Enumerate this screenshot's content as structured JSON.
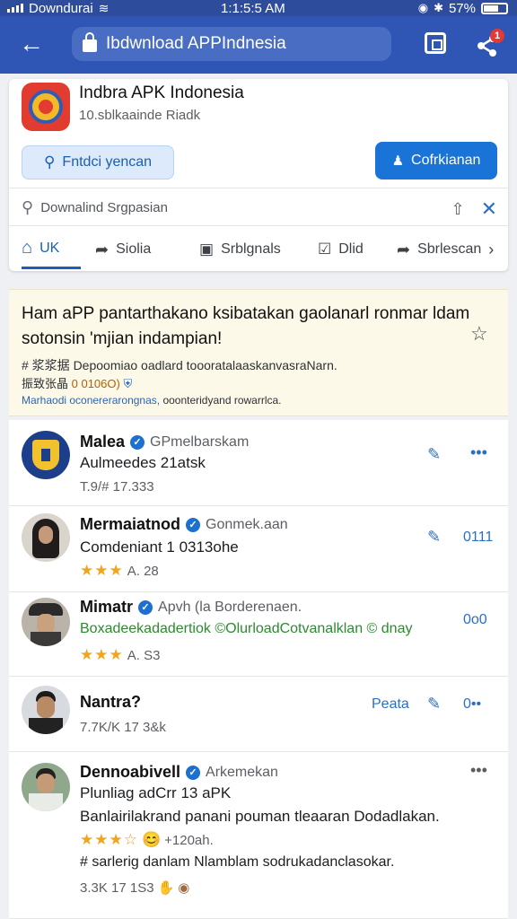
{
  "status_bar": {
    "carrier": "Downdurai",
    "time": "1:1:5:5 AM",
    "battery": "57%"
  },
  "app_bar": {
    "url": "Ibdwnload APPIndnesia",
    "badge": "1"
  },
  "app_card": {
    "title": "Indbra APK Indonesia",
    "subtitle": "10.sblkaainde Riadk",
    "btn_outline": "Fntdci yencan",
    "btn_primary": "Cofrkianan",
    "search_label": "Downalind Srgpasian",
    "tabs": [
      {
        "label": "UK",
        "active": true
      },
      {
        "label": "Siolia"
      },
      {
        "label": "Srblgnals"
      },
      {
        "label": "Dlid"
      },
      {
        "label": "Sbrlescan"
      }
    ]
  },
  "notice": {
    "line1": "Ham aPP pantarthakano ksibatakan gaolanarl ronmar ldam",
    "line2": "sotonsin 'mjian indampian!",
    "line3": "# 浆浆据 Depoomiao oadlard toooratalaaskanvasraNarn.",
    "line4_prefix": "振致张晶 ",
    "line4_code": "0 0106O)",
    "line5_link": "Marhaodi oconererarongnas,",
    "line5_rest": " ooonteridyand rowarrlca."
  },
  "comments": [
    {
      "name": "Malea",
      "handle": "GPmelbarskam",
      "text": "Aulmeedes 21atsk",
      "meta": "T.9/# 17.333",
      "actions": [
        "edit",
        "more"
      ]
    },
    {
      "name": "Mermaiatnod",
      "handle": "Gonmek.aan",
      "text": "Comdeniant 1 0313ohe",
      "rating": "★★★",
      "meta": "A. 28",
      "actions_text": "0111"
    },
    {
      "name": "Mimatr",
      "handle": "Apvh  (la Borderenaen.",
      "text": "Boxadeekadadertiok ©OlurloadCotvanalklan © dnay",
      "rating": "★★★",
      "meta": "A. S3",
      "actions_text": "0o0"
    },
    {
      "name": "Nantra?",
      "meta": "7.7K/K 17 3&k",
      "action_label": "Peata",
      "actions_text": "0••"
    },
    {
      "name": "Dennoabivell",
      "handle": "Arkemekan",
      "text": "Plunliag adCrr 13 aPK",
      "text2": "Banlairilakrand panani pouman tleaaran Dodadlakan.",
      "rating": "★★★☆",
      "meta": "+120ah.",
      "text3": "# sarlerig danlam Nlamblam  sodrukadanclasokar.",
      "meta2": "3.3K 17 1S3"
    }
  ]
}
